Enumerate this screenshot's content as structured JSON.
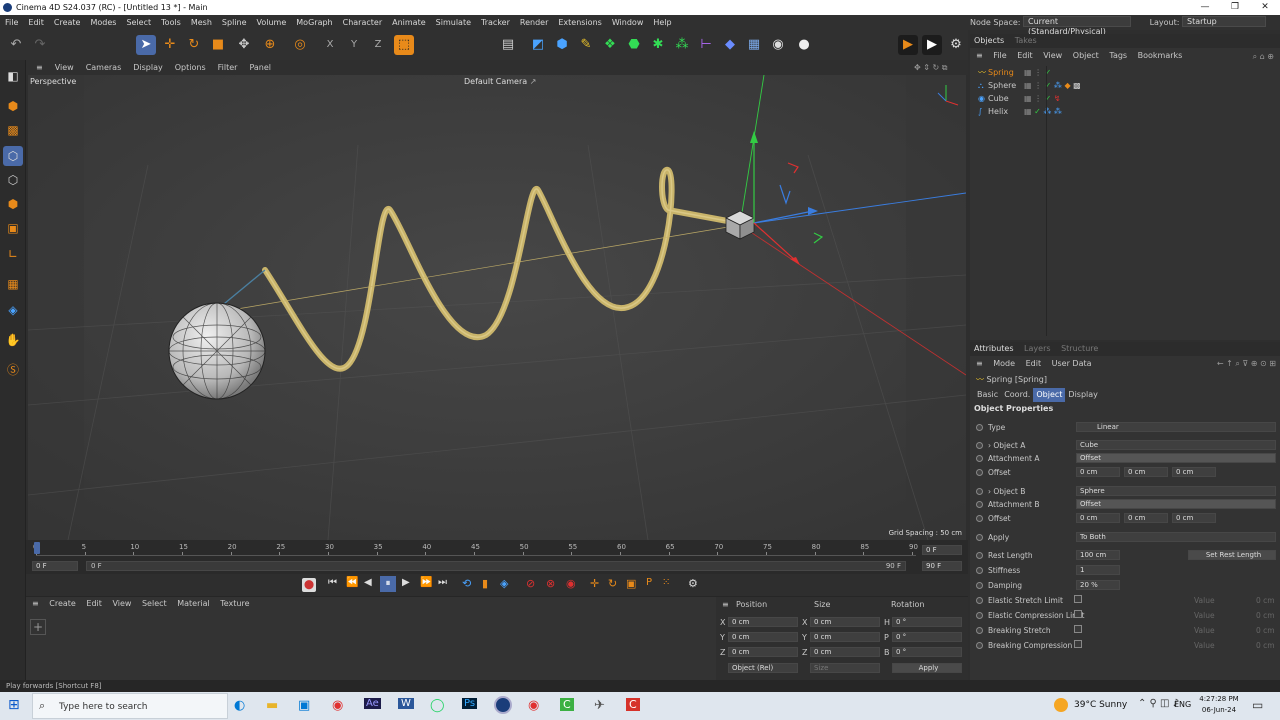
{
  "window": {
    "title": "Cinema 4D S24.037 (RC) - [Untitled 13 *] - Main",
    "controls": [
      "—",
      "❐",
      "✕"
    ]
  },
  "menubar": {
    "items": [
      "File",
      "Edit",
      "Create",
      "Modes",
      "Select",
      "Tools",
      "Mesh",
      "Spline",
      "Volume",
      "MoGraph",
      "Character",
      "Animate",
      "Simulate",
      "Tracker",
      "Render",
      "Extensions",
      "Window",
      "Help"
    ],
    "node_space_label": "Node Space:",
    "node_space_value": "Current (Standard/Physical)",
    "layout_label": "Layout:",
    "layout_value": "Startup"
  },
  "viewport": {
    "menu": [
      "View",
      "Cameras",
      "Display",
      "Options",
      "Filter",
      "Panel"
    ],
    "view_name": "Perspective",
    "camera_name": "Default Camera",
    "grid_spacing": "Grid Spacing : 50 cm"
  },
  "timeline": {
    "ticks": [
      "0",
      "5",
      "10",
      "15",
      "20",
      "25",
      "30",
      "35",
      "40",
      "45",
      "50",
      "55",
      "60",
      "65",
      "70",
      "75",
      "80",
      "85",
      "90"
    ],
    "current_frame": "0 F",
    "end_frame_display": "0 F",
    "start_field": "0 F",
    "range_start": "0 F",
    "range_end": "90 F",
    "end_field": "90 F",
    "playhead_fraction": 0
  },
  "material_manager": {
    "menu": [
      "Create",
      "Edit",
      "View",
      "Select",
      "Material",
      "Texture"
    ]
  },
  "coord_manager": {
    "headers": [
      "Position",
      "Size",
      "Rotation"
    ],
    "rows": [
      {
        "axis": "X",
        "pos": "0 cm",
        "saxis": "X",
        "size": "0 cm",
        "raxis": "H",
        "rot": "0 °"
      },
      {
        "axis": "Y",
        "pos": "0 cm",
        "saxis": "Y",
        "size": "0 cm",
        "raxis": "P",
        "rot": "0 °"
      },
      {
        "axis": "Z",
        "pos": "0 cm",
        "saxis": "Z",
        "size": "0 cm",
        "raxis": "B",
        "rot": "0 °"
      }
    ],
    "mode": "Object (Rel)",
    "size_mode": "Size",
    "apply": "Apply"
  },
  "objects_panel": {
    "tabs": [
      "Objects",
      "Takes"
    ],
    "menu": [
      "File",
      "Edit",
      "View",
      "Object",
      "Tags",
      "Bookmarks"
    ],
    "items": [
      {
        "name": "Spring",
        "selected": true
      },
      {
        "name": "Sphere",
        "selected": false
      },
      {
        "name": "Cube",
        "selected": false
      },
      {
        "name": "Helix",
        "selected": false
      }
    ]
  },
  "attributes": {
    "tabs": [
      "Attributes",
      "Layers",
      "Structure"
    ],
    "menu": [
      "Mode",
      "Edit",
      "User Data"
    ],
    "object_title": "Spring [Spring]",
    "subtabs": [
      "Basic",
      "Coord.",
      "Object",
      "Display"
    ],
    "active_subtab": "Object",
    "section": "Object Properties",
    "type_label": "Type",
    "type_value": "Linear",
    "object_a_label": "Object A",
    "object_a_value": "Cube",
    "attachment_a_label": "Attachment A",
    "attachment_a_value": "Offset",
    "offset_a_label": "Offset",
    "offset_a": [
      "0 cm",
      "0 cm",
      "0 cm"
    ],
    "object_b_label": "Object B",
    "object_b_value": "Sphere",
    "attachment_b_label": "Attachment B",
    "attachment_b_value": "Offset",
    "offset_b_label": "Offset",
    "offset_b": [
      "0 cm",
      "0 cm",
      "0 cm"
    ],
    "apply_label": "Apply",
    "apply_value": "To Both",
    "rest_length_label": "Rest Length",
    "rest_length_value": "100 cm",
    "set_rest_length": "Set Rest Length",
    "stiffness_label": "Stiffness",
    "stiffness_value": "1",
    "damping_label": "Damping",
    "damping_value": "20 %",
    "flags": [
      {
        "label": "Elastic Stretch Limit",
        "value_label": "Value",
        "value": "0 cm"
      },
      {
        "label": "Elastic Compression Limit",
        "value_label": "Value",
        "value": "0 cm"
      },
      {
        "label": "Breaking Stretch",
        "value_label": "Value",
        "value": "0 cm"
      },
      {
        "label": "Breaking Compression",
        "value_label": "Value",
        "value": "0 cm"
      }
    ]
  },
  "status": "Play forwards [Shortcut F8]",
  "taskbar": {
    "search_placeholder": "Type here to search",
    "weather": "39°C  Sunny",
    "lang": "ENG",
    "time": "4:27:28 PM",
    "date": "06-Jun-24"
  },
  "colors": {
    "accent": "#4a6aa8",
    "orange": "#e88a1a",
    "spring": "#c9b46a",
    "axis_x": "#e03030",
    "axis_y": "#33cc44",
    "axis_z": "#3a7de0"
  }
}
